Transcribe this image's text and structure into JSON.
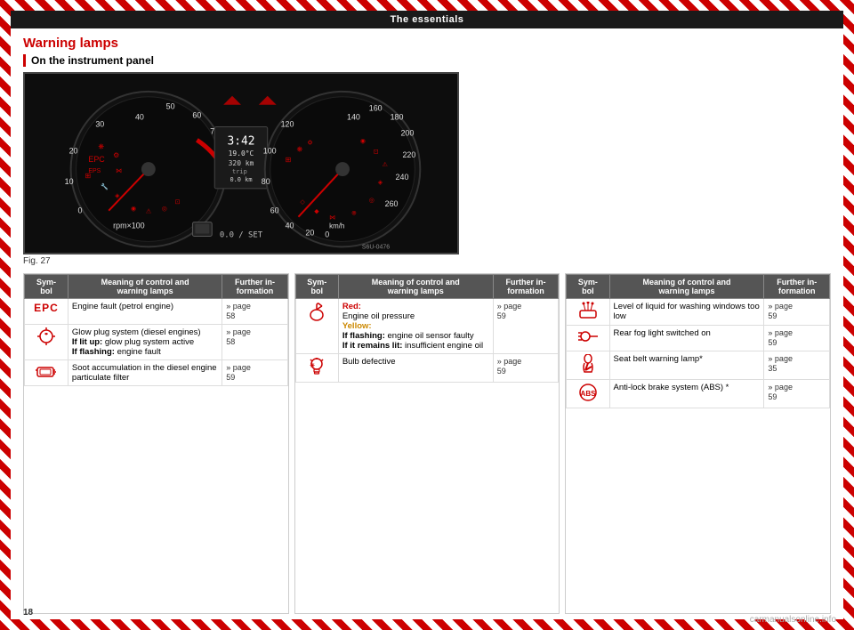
{
  "page": {
    "number": "18",
    "watermark": "carmanualsonline.info"
  },
  "header": {
    "title": "The essentials"
  },
  "section": {
    "title": "Warning lamps",
    "subsection": "On the instrument panel"
  },
  "figure": {
    "label": "Fig. 27",
    "id": "S6U-0476",
    "digital_display": {
      "time": "3:42",
      "temp": "19.0°C",
      "distance": "320 km",
      "trip": "0.0 km",
      "speed": "0.0 / SET"
    }
  },
  "tables": [
    {
      "id": "table1",
      "headers": [
        "Sym-bol",
        "Meaning of control and warning lamps",
        "Further in-formation"
      ],
      "rows": [
        {
          "symbol": "EPC",
          "symbol_type": "epc",
          "meaning": "Engine fault (petrol engine)",
          "further": "» page 58"
        },
        {
          "symbol": "~",
          "symbol_type": "glow",
          "meaning": "Glow plug system (diesel engines)\nIf lit up: glow plug system active\nIf flashing: engine fault",
          "further": "» page 58"
        },
        {
          "symbol": "engine-particulate",
          "symbol_type": "particulate",
          "meaning": "Soot accumulation in the diesel engine particulate filter",
          "further": "» page 59"
        }
      ]
    },
    {
      "id": "table2",
      "headers": [
        "Sym-bol",
        "Meaning of control and warning lamps",
        "Further in-formation"
      ],
      "rows": [
        {
          "symbol": "oil-drop",
          "symbol_type": "oil",
          "meaning_parts": [
            {
              "label": "Red:",
              "text": "Engine oil pressure"
            },
            {
              "label": "Yellow:",
              "text": ""
            },
            {
              "label": "If flashing:",
              "text": "engine oil sensor faulty"
            },
            {
              "label": "If it remains lit:",
              "text": "insufficient engine oil"
            }
          ],
          "further": "» page 59"
        },
        {
          "symbol": "bulb",
          "symbol_type": "bulb",
          "meaning": "Bulb defective",
          "further": "» page 59"
        }
      ]
    },
    {
      "id": "table3",
      "headers": [
        "Sym-bol",
        "Meaning of control and warning lamps",
        "Further in-formation"
      ],
      "rows": [
        {
          "symbol": "washer",
          "symbol_type": "washer",
          "meaning": "Level of liquid for washing windows too low",
          "further": "» page 59"
        },
        {
          "symbol": "rear-fog",
          "symbol_type": "rear-fog",
          "meaning": "Rear fog light switched on",
          "further": "» page 59"
        },
        {
          "symbol": "seatbelt",
          "symbol_type": "seatbelt",
          "meaning": "Seat belt warning lamp*",
          "further": "» page 35"
        },
        {
          "symbol": "abs",
          "symbol_type": "abs",
          "meaning": "Anti-lock brake system (ABS) *",
          "further": "» page 59"
        }
      ]
    }
  ]
}
